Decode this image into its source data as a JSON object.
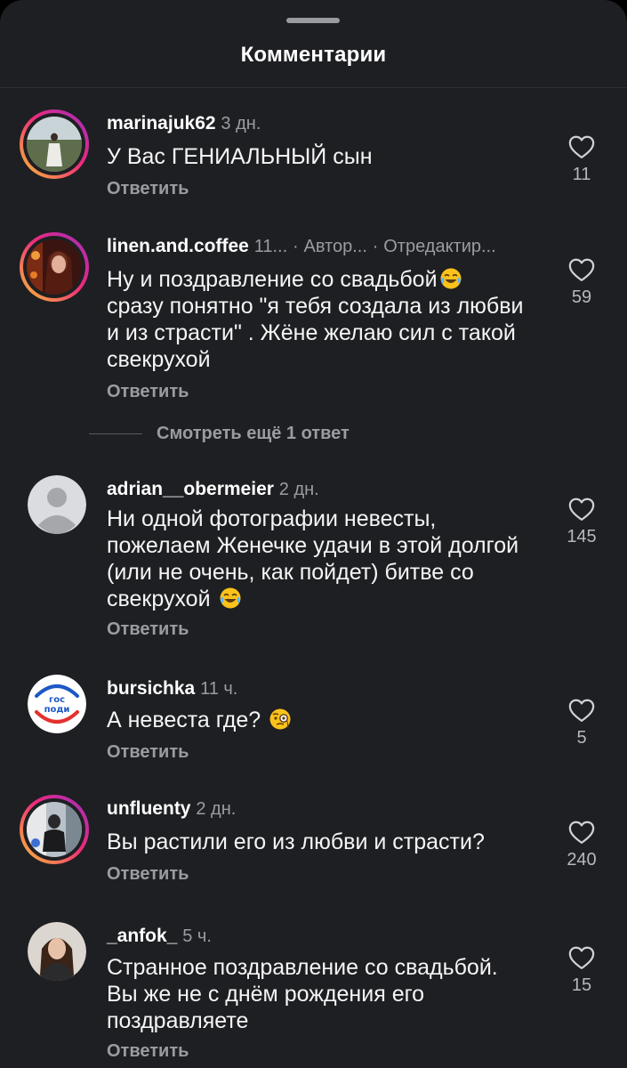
{
  "sheet": {
    "title": "Комментарии"
  },
  "colors": {
    "background": "#1e1f22",
    "text_primary": "#f5f5f5",
    "text_secondary": "#9a9ca1",
    "story_ring": [
      "#f9c334",
      "#ee2a7b",
      "#9b2fc1"
    ]
  },
  "comments": [
    {
      "username": "marinajuk62",
      "time": "3 дн.",
      "text": "У Вас ГЕНИАЛЬНЫЙ сын",
      "reply_label": "Ответить",
      "likes": "11",
      "like_icon": "heart-outline-icon"
    },
    {
      "username": "linen.and.coffee",
      "time": "11...",
      "author_label": "Автор...",
      "edited_label": "Отредактир...",
      "text": "Ну и поздравление со свадьбой",
      "text_emoji": "face-with-tears-of-joy",
      "text_rest": "сразу понятно \"я тебя создала из любви и из страсти\" . Жёне желаю сил с такой свекрухой",
      "reply_label": "Ответить",
      "likes": "59",
      "like_icon": "heart-outline-icon"
    },
    {
      "username": "adrian__obermeier",
      "time": "2 дн.",
      "text": "Ни одной фотографии невесты, пожелаем Женечке удачи в этой долгой (или не очень, как пойдет) битве со свекрухой",
      "text_emoji": "face-with-tears-of-joy",
      "reply_label": "Ответить",
      "likes": "145",
      "like_icon": "heart-outline-icon"
    },
    {
      "username": "bursichka",
      "time": "11 ч.",
      "text": "А невеста где?",
      "text_emoji": "face-with-monocle",
      "avatar_text": [
        "гос",
        "поди"
      ],
      "reply_label": "Ответить",
      "likes": "5",
      "like_icon": "heart-outline-icon"
    },
    {
      "username": "unfluenty",
      "time": "2 дн.",
      "text": "Вы растили его из любви и страсти?",
      "reply_label": "Ответить",
      "likes": "240",
      "like_icon": "heart-outline-icon"
    },
    {
      "username": "_anfok_",
      "time": "5 ч.",
      "text": "Странное поздравление со свадьбой. Вы же не с днём рождения его поздравляете",
      "reply_label": "Ответить",
      "likes": "15",
      "like_icon": "heart-outline-icon"
    }
  ],
  "view_replies": "Смотреть ещё 1 ответ"
}
